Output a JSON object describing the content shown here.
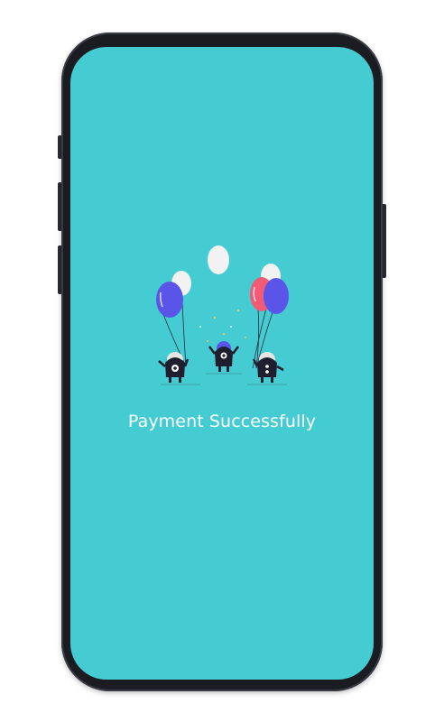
{
  "screen": {
    "message": "Payment Successfully",
    "background_color": "#45cbd2",
    "message_color": "#ffffff"
  },
  "illustration": {
    "icon": "celebration-balloons-illustration",
    "balloon_colors": [
      "#5a55e8",
      "#f15b76",
      "#f2f2f2"
    ],
    "character_color": "#1e1e2e"
  }
}
